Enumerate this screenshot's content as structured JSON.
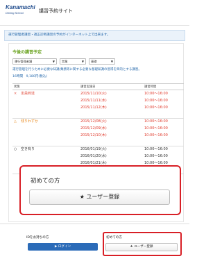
{
  "header": {
    "logo_main": "Kanamachi",
    "logo_sub": "Driving School",
    "app_title": "講習予約サイト"
  },
  "notice": "運行管理者講習・適正診断講習の予約がインターネット上で出来ます。",
  "section": {
    "title": "今後の講習予定",
    "filters": [
      "運行管理者講",
      "営業",
      "基礎"
    ],
    "description": "運行管理を行うために必要な知識/業務等に関する必要な基礎知識の習得を目的とする講習。",
    "count": "16時間　9,180円(税込)"
  },
  "table": {
    "headers": [
      "状態",
      "講習実施日",
      "講習時間"
    ],
    "rows": [
      {
        "status_icon": "×",
        "status": "定員到達",
        "status_color": "#e04a3a",
        "dates": [
          "2015/11/10(火)",
          "2015/11/11(水)",
          "2015/11/12(木)"
        ],
        "times": [
          "10:00〜16:00",
          "10:00〜16:00",
          "10:00〜16:00"
        ],
        "color": "#e0392b"
      },
      {
        "status_icon": "△",
        "status": "残りわずか",
        "status_color": "#e8891d",
        "dates": [
          "2015/12/08(火)",
          "2015/12/09(水)",
          "2015/12/10(木)"
        ],
        "times": [
          "10:00〜16:00",
          "10:00〜16:00",
          "10:00〜16:00"
        ],
        "color": "#e0392b"
      },
      {
        "status_icon": "○",
        "status": "空き有り",
        "status_color": "#333333",
        "dates": [
          "2016/01/19(火)",
          "2016/01/20(水)",
          "2016/01/21(木)"
        ],
        "times": [
          "10:00〜16:00",
          "10:00〜16:00",
          "10:00〜16:00"
        ],
        "color": "#333333"
      }
    ]
  },
  "callout": {
    "title": "初めての方",
    "button": "★ ユーザー登録"
  },
  "footer": {
    "login_label": "IDをお持ちの方",
    "login_button": "▶ ログイン",
    "first_label": "初めての方",
    "register_button": "★ ユーザー登録"
  }
}
